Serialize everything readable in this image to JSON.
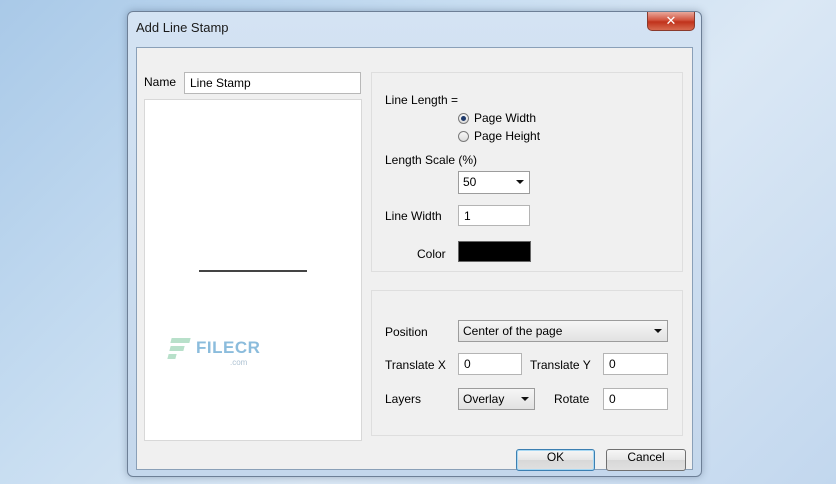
{
  "window": {
    "title": "Add Line Stamp",
    "close_glyph": "✕"
  },
  "name": {
    "label": "Name",
    "value": "Line Stamp"
  },
  "watermark": {
    "text": "FILECR",
    "sub": ".com"
  },
  "line_settings": {
    "line_length_label": "Line Length =",
    "options": [
      {
        "label": "Page Width",
        "selected": true
      },
      {
        "label": "Page Height",
        "selected": false
      }
    ],
    "length_scale_label": "Length Scale (%)",
    "length_scale_value": "50",
    "line_width_label": "Line Width",
    "line_width_value": "1",
    "color_label": "Color",
    "color_value": "#000000"
  },
  "placement": {
    "position_label": "Position",
    "position_value": "Center of the page",
    "translate_x_label": "Translate X",
    "translate_x_value": "0",
    "translate_y_label": "Translate Y",
    "translate_y_value": "0",
    "layers_label": "Layers",
    "layers_value": "Overlay",
    "rotate_label": "Rotate",
    "rotate_value": "0"
  },
  "buttons": {
    "ok": "OK",
    "cancel": "Cancel"
  },
  "icons": {
    "close": "close-icon",
    "dropdown": "chevron-down-icon"
  }
}
